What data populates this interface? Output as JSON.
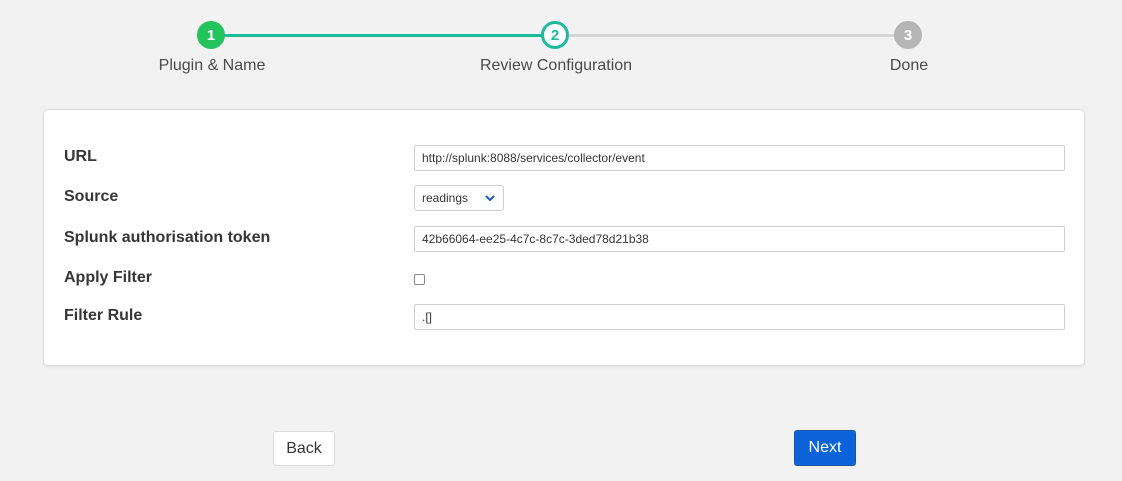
{
  "stepper": {
    "steps": [
      {
        "number": "1",
        "label": "Plugin & Name",
        "state": "complete"
      },
      {
        "number": "2",
        "label": "Review Configuration",
        "state": "active"
      },
      {
        "number": "3",
        "label": "Done",
        "state": "pending"
      }
    ],
    "colors": {
      "complete": "#23c45e",
      "active": "#1abc9c",
      "pending": "#b5b5b5"
    }
  },
  "form": {
    "url": {
      "label": "URL",
      "value": "http://splunk:8088/services/collector/event"
    },
    "source": {
      "label": "Source",
      "value": "readings"
    },
    "token": {
      "label": "Splunk authorisation token",
      "value": "42b66064-ee25-4c7c-8c7c-3ded78d21b38"
    },
    "apply_filter": {
      "label": "Apply Filter",
      "checked": false
    },
    "filter_rule": {
      "label": "Filter Rule",
      "value": ".[]"
    }
  },
  "buttons": {
    "back": "Back",
    "next": "Next"
  },
  "accent_color": "#0c63d9"
}
